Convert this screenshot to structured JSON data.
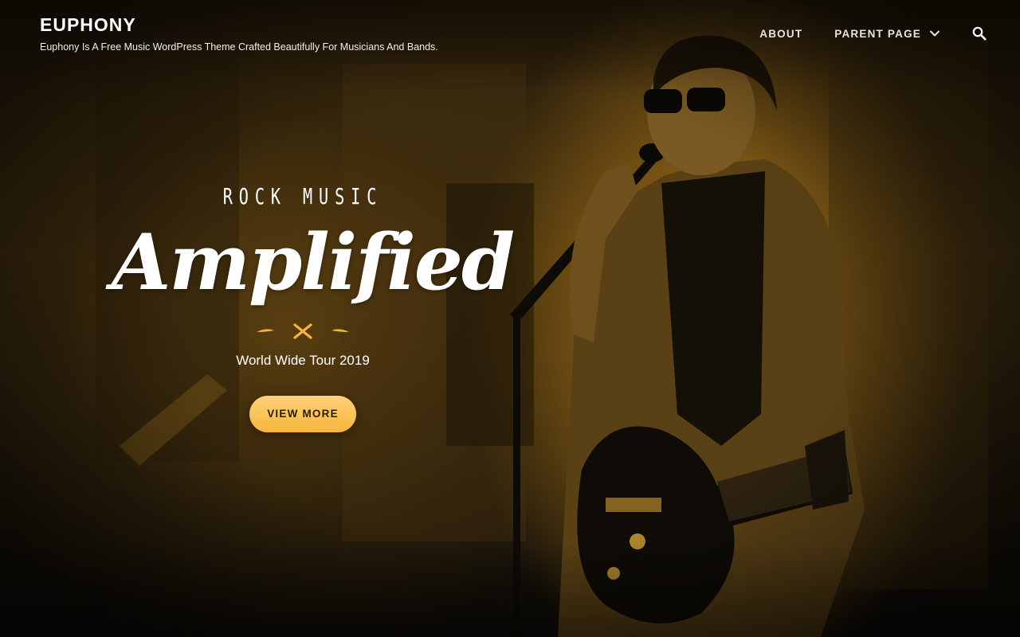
{
  "site": {
    "title": "EUPHONY",
    "description": "Euphony Is A Free Music WordPress Theme Crafted Beautifully For Musicians And Bands."
  },
  "nav": {
    "items": [
      {
        "label": "ABOUT"
      },
      {
        "label": "PARENT PAGE",
        "has_submenu": true
      }
    ],
    "search_icon": "search-icon",
    "submenu_icon": "chevron-down-icon"
  },
  "hero": {
    "kicker": "ROCK MUSIC",
    "title": "Amplified",
    "subtitle": "World Wide Tour 2019",
    "cta_label": "VIEW MORE",
    "separator_icon": "crossed-drumsticks-icon",
    "image_description_icon": "singer-guitarist-photo"
  },
  "colors": {
    "accent": "#f8b53a",
    "accent_light": "#ffd27a",
    "image_tint": "#c48c20",
    "text": "#ffffff"
  }
}
